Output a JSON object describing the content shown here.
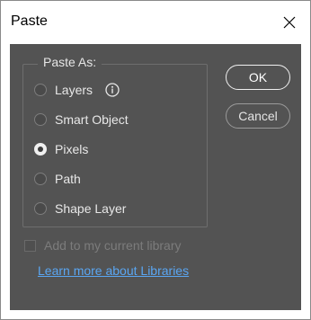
{
  "window": {
    "title": "Paste"
  },
  "paste_as": {
    "legend": "Paste As:",
    "options": [
      {
        "label": "Layers",
        "checked": false
      },
      {
        "label": "Smart Object",
        "checked": false
      },
      {
        "label": "Pixels",
        "checked": true
      },
      {
        "label": "Path",
        "checked": false
      },
      {
        "label": "Shape Layer",
        "checked": false
      }
    ]
  },
  "buttons": {
    "ok": "OK",
    "cancel": "Cancel"
  },
  "library": {
    "checkbox_label": "Add to my current library",
    "checked": false,
    "enabled": false,
    "link_text": "Learn more about Libraries"
  },
  "icons": {
    "close": "close-icon",
    "info": "info-icon"
  },
  "colors": {
    "panel_bg": "#535353",
    "link": "#5aa6f2",
    "text": "#e8e8e8",
    "disabled_text": "#7c7c7c"
  }
}
